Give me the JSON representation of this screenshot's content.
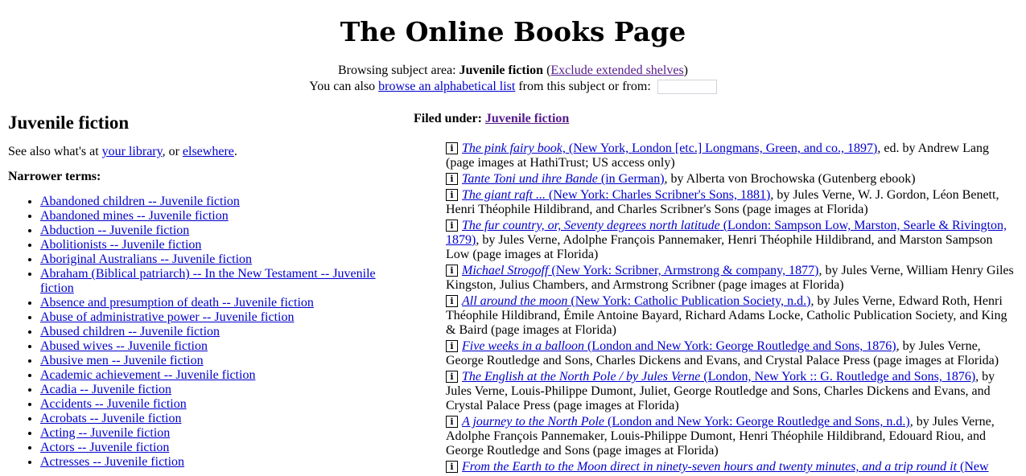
{
  "page": {
    "title": "The Online Books Page",
    "browse_prefix": "Browsing subject area: ",
    "subject": "Juvenile fiction",
    "paren_open": " (",
    "exclude_link": "Exclude extended shelves",
    "paren_close": ")",
    "also_prefix": "You can also ",
    "alpha_link": "browse an alphabetical list",
    "also_suffix": " from this subject or from:",
    "search_value": ""
  },
  "left": {
    "heading": "Juvenile fiction",
    "see_also_prefix": "See also what's at ",
    "library_link": "your library",
    "or_text": ", or ",
    "elsewhere_link": "elsewhere",
    "period": ".",
    "narrower_label": "Narrower terms:",
    "terms": [
      "Abandoned children -- Juvenile fiction",
      "Abandoned mines -- Juvenile fiction",
      "Abduction -- Juvenile fiction",
      "Abolitionists -- Juvenile fiction",
      "Aboriginal Australians -- Juvenile fiction",
      "Abraham (Biblical patriarch) -- In the New Testament -- Juvenile fiction",
      "Absence and presumption of death -- Juvenile fiction",
      "Abuse of administrative power -- Juvenile fiction",
      "Abused children -- Juvenile fiction",
      "Abused wives -- Juvenile fiction",
      "Abusive men -- Juvenile fiction",
      "Academic achievement -- Juvenile fiction",
      "Acadia -- Juvenile fiction",
      "Accidents -- Juvenile fiction",
      "Acrobats -- Juvenile fiction",
      "Acting -- Juvenile fiction",
      "Actors -- Juvenile fiction",
      "Actresses -- Juvenile fiction"
    ]
  },
  "right": {
    "filed_label": "Filed under: ",
    "filed_link": "Juvenile fiction",
    "entries": [
      {
        "title": "The pink fairy book,",
        "pub": " (New York, London [etc.] Longmans, Green, and co., 1897)",
        "rest": ", ed. by Andrew Lang (page images at HathiTrust; US access only)"
      },
      {
        "title": "Tante Toni und ihre Bande",
        "pub": " (in German)",
        "rest": ", by Alberta von Brochowska (Gutenberg ebook)"
      },
      {
        "title": "The giant raft ...",
        "pub": " (New York: Charles Scribner's Sons, 1881)",
        "rest": ", by Jules Verne, W. J. Gordon, Léon Benett, Henri Théophile Hildibrand, and Charles Scribner's Sons (page images at Florida)"
      },
      {
        "title": "The fur country, or, Seventy degrees north latitude",
        "pub": " (London: Sampson Low, Marston, Searle & Rivington, 1879)",
        "rest": ", by Jules Verne, Adolphe François Pannemaker, Henri Théophile Hildibrand, and Marston Sampson Low (page images at Florida)"
      },
      {
        "title": "Michael Strogoff",
        "pub": " (New York: Scribner, Armstrong & company, 1877)",
        "rest": ", by Jules Verne, William Henry Giles Kingston, Julius Chambers, and Armstrong Scribner (page images at Florida)"
      },
      {
        "title": "All around the moon",
        "pub": " (New York: Catholic Publication Society, n.d.)",
        "rest": ", by Jules Verne, Edward Roth, Henri Théophile Hildibrand, Émile Antoine Bayard, Richard Adams Locke, Catholic Publication Society, and King & Baird (page images at Florida)"
      },
      {
        "title": "Five weeks in a balloon",
        "pub": " (London and New York: George Routledge and Sons, 1876)",
        "rest": ", by Jules Verne, George Routledge and Sons, Charles Dickens and Evans, and Crystal Palace Press (page images at Florida)"
      },
      {
        "title": "The English at the North Pole / by Jules Verne",
        "pub": " (London, New York :: G. Routledge and Sons, 1876)",
        "rest": ", by Jules Verne, Louis-Philippe Dumont, Juliet, George Routledge and Sons, Charles Dickens and Evans, and Crystal Palace Press (page images at Florida)"
      },
      {
        "title": "A journey to the North Pole",
        "pub": " (London and New York: George Routledge and Sons, n.d.)",
        "rest": ", by Jules Verne, Adolphe François Pannemaker, Louis-Philippe Dumont, Henri Théophile Hildibrand, Edouard Riou, and George Routledge and Sons (page images at Florida)"
      },
      {
        "title": "From the Earth to the Moon direct in ninety-seven hours and twenty minutes, and a trip round it",
        "pub": " (New",
        "rest": ""
      }
    ],
    "info_icon": "info-icon"
  }
}
